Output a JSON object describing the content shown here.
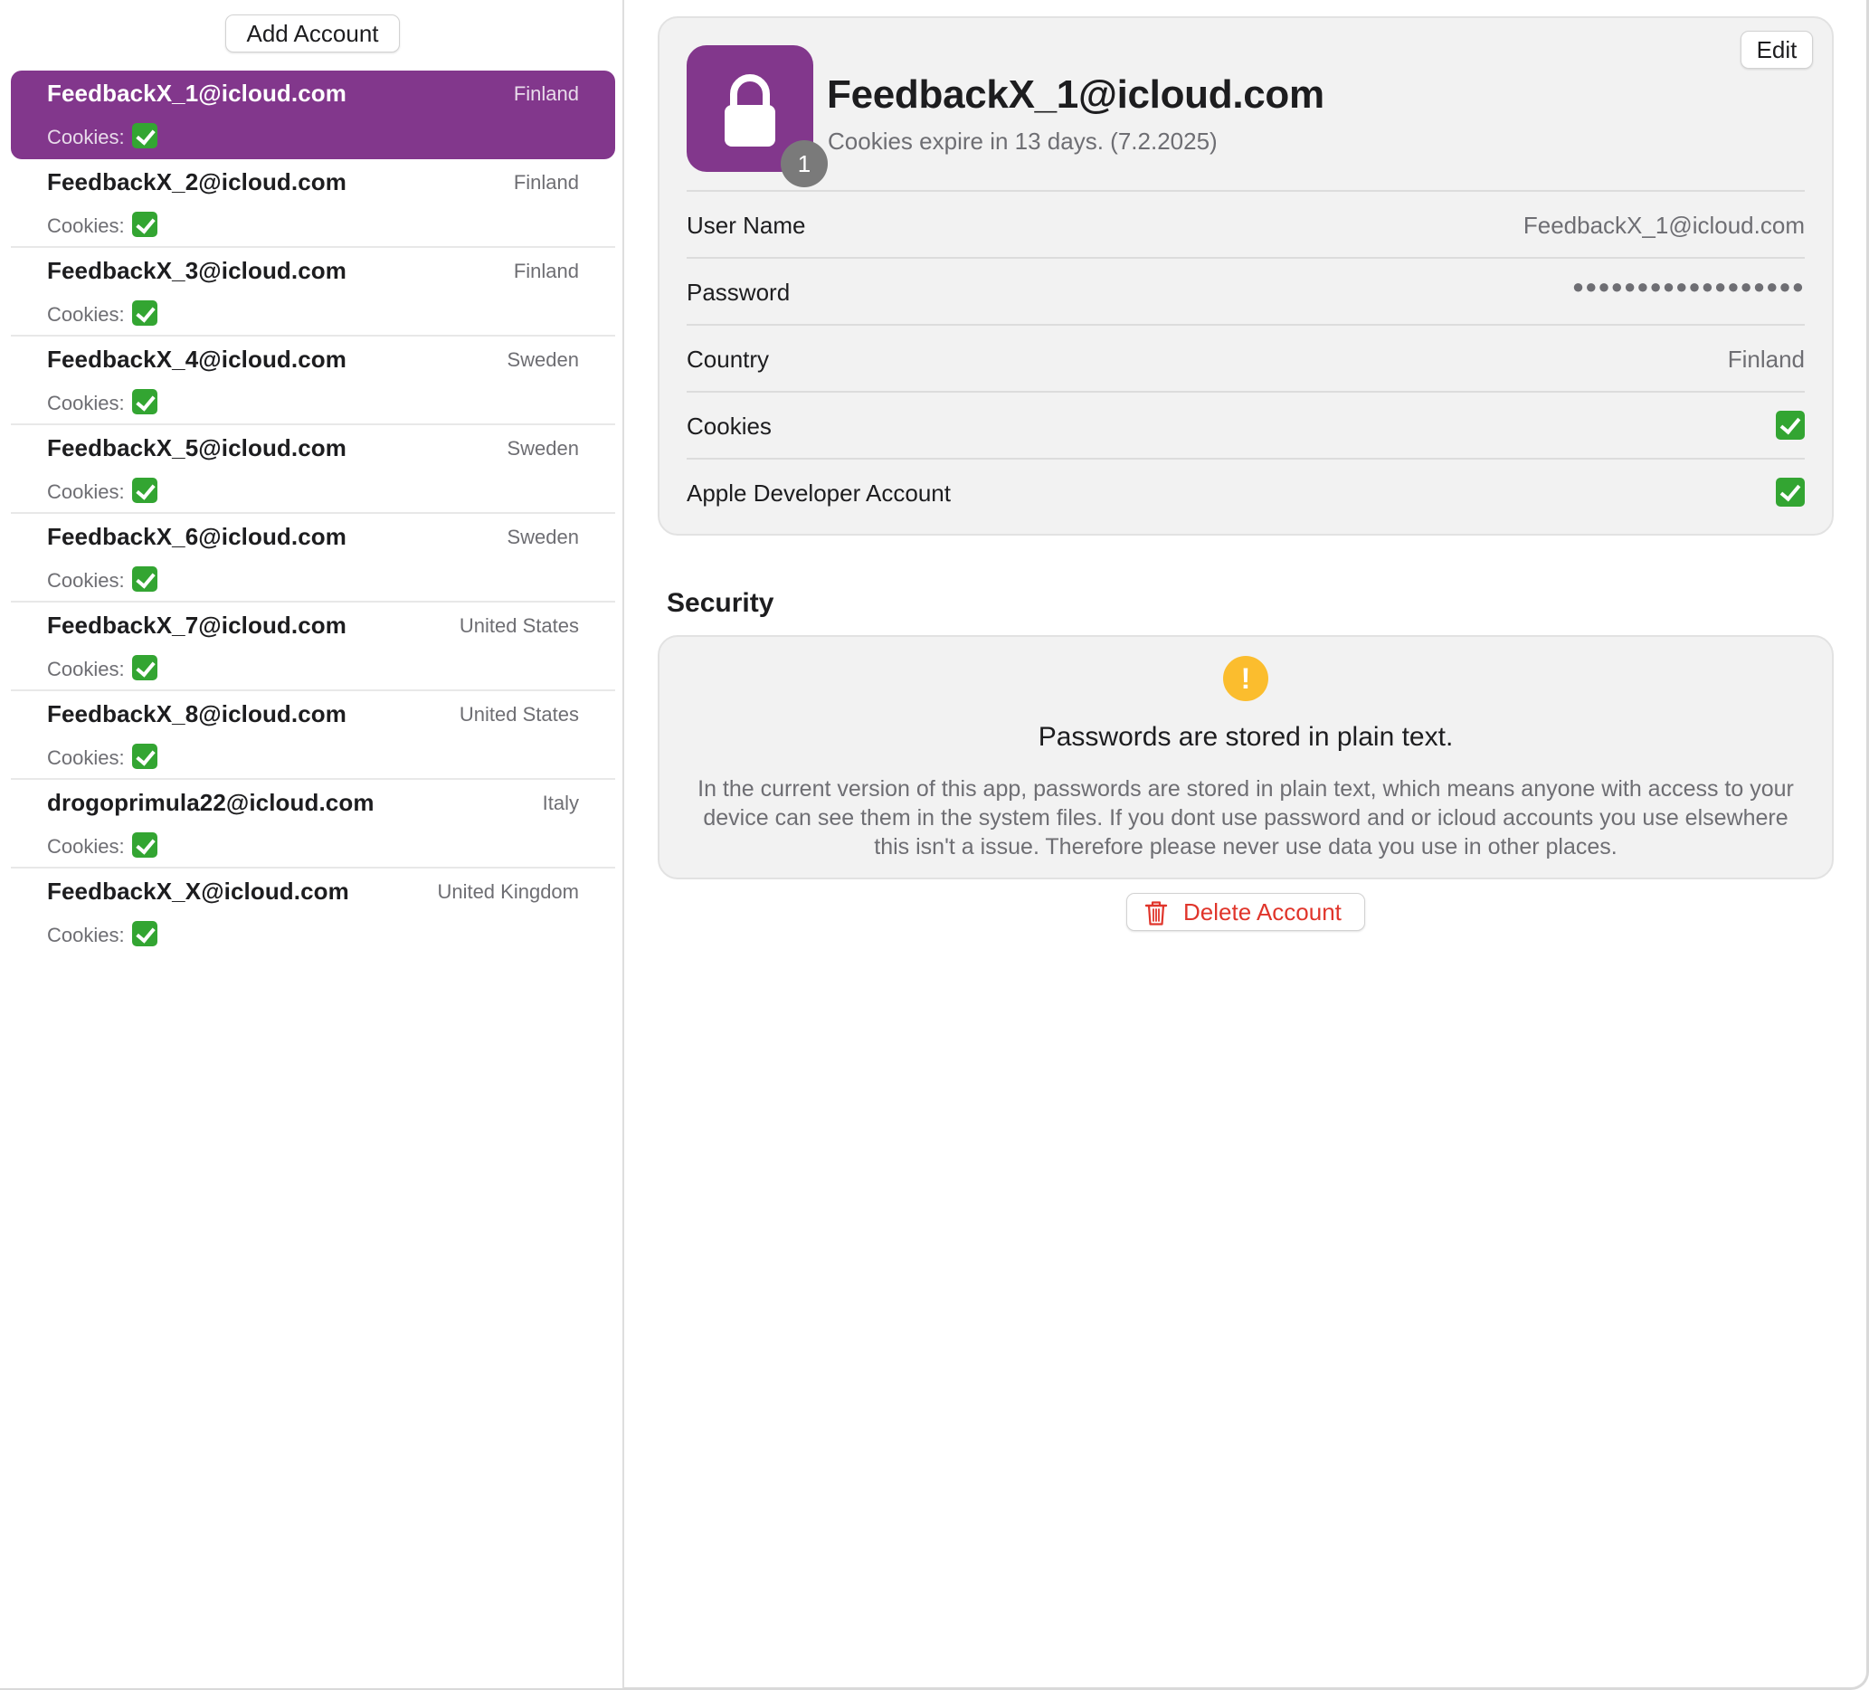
{
  "sidebar": {
    "add_account_label": "Add Account",
    "accounts": [
      {
        "email": "FeedbackX_1@icloud.com",
        "country": "Finland",
        "cookies_label": "Cookies:",
        "selected": true
      },
      {
        "email": "FeedbackX_2@icloud.com",
        "country": "Finland",
        "cookies_label": "Cookies:"
      },
      {
        "email": "FeedbackX_3@icloud.com",
        "country": "Finland",
        "cookies_label": "Cookies:"
      },
      {
        "email": "FeedbackX_4@icloud.com",
        "country": "Sweden",
        "cookies_label": "Cookies:"
      },
      {
        "email": "FeedbackX_5@icloud.com",
        "country": "Sweden",
        "cookies_label": "Cookies:"
      },
      {
        "email": "FeedbackX_6@icloud.com",
        "country": "Sweden",
        "cookies_label": "Cookies:"
      },
      {
        "email": "FeedbackX_7@icloud.com",
        "country": "United States",
        "cookies_label": "Cookies:"
      },
      {
        "email": "FeedbackX_8@icloud.com",
        "country": "United States",
        "cookies_label": "Cookies:"
      },
      {
        "email": "drogoprimula22@icloud.com",
        "country": "Italy",
        "cookies_label": "Cookies:"
      },
      {
        "email": "FeedbackX_X@icloud.com",
        "country": "United Kingdom",
        "cookies_label": "Cookies:"
      }
    ]
  },
  "detail": {
    "edit_label": "Edit",
    "badge_count": "1",
    "title": "FeedbackX_1@icloud.com",
    "subtitle": "Cookies expire in 13 days. (7.2.2025)",
    "fields": {
      "username": {
        "label": "User Name",
        "value": "FeedbackX_1@icloud.com"
      },
      "password": {
        "label": "Password",
        "value": "●●●●●●●●●●●●●●●●●●"
      },
      "country": {
        "label": "Country",
        "value": "Finland"
      },
      "cookies": {
        "label": "Cookies"
      },
      "developer": {
        "label": "Apple Developer Account"
      }
    },
    "security": {
      "section_title": "Security",
      "warning_icon": "exclamation-icon",
      "warning_title": "Passwords are stored in plain text.",
      "warning_body": "In the current version of this app, passwords are stored in plain text, which means anyone with access to your device can see them in the system files. If you dont use password and or icloud accounts you use elsewhere this isn't a issue. Therefore please never use data you use in other places."
    },
    "delete_label": "Delete Account"
  },
  "colors": {
    "accent": "#82378c",
    "check_green": "#33a532",
    "warning_yellow": "#fbbd2e",
    "destructive_red": "#e0352b"
  }
}
